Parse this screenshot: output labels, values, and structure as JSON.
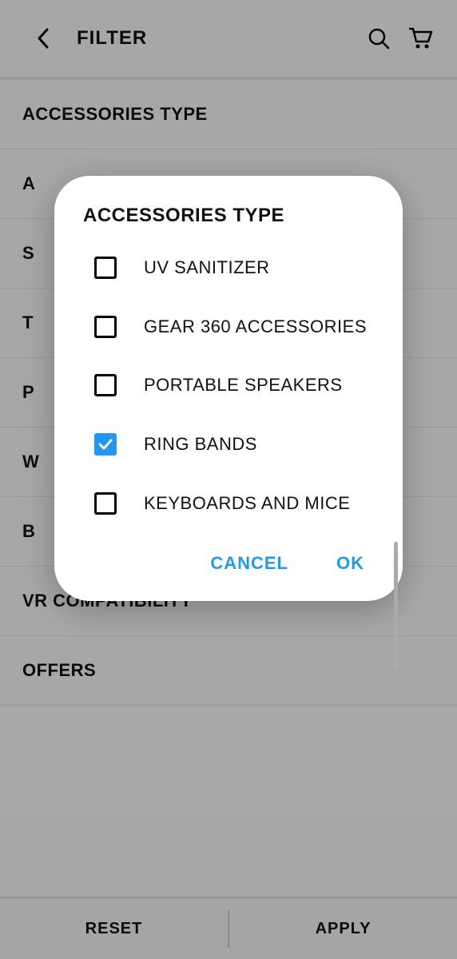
{
  "header": {
    "title": "FILTER"
  },
  "sections": [
    "ACCESSORIES TYPE",
    "A",
    "S",
    "T",
    "P",
    "W",
    "B",
    "VR COMPATIBILITY",
    "OFFERS"
  ],
  "bottom": {
    "reset": "RESET",
    "apply": "APPLY"
  },
  "modal": {
    "title": "ACCESSORIES TYPE",
    "options": [
      {
        "label": "UV SANITIZER",
        "checked": false
      },
      {
        "label": "GEAR 360 ACCESSORIES",
        "checked": false
      },
      {
        "label": "PORTABLE SPEAKERS",
        "checked": false
      },
      {
        "label": "RING BANDS",
        "checked": true
      },
      {
        "label": "KEYBOARDS AND MICE",
        "checked": false
      }
    ],
    "cancel": "CANCEL",
    "ok": "OK"
  }
}
